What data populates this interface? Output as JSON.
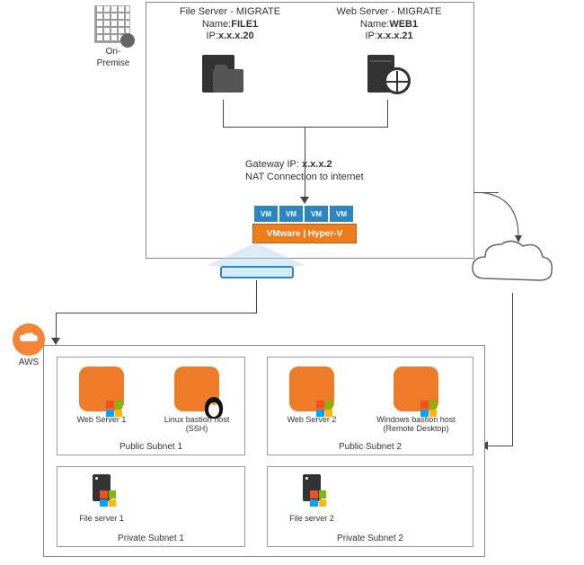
{
  "onprem": {
    "label": "On-\nPremise",
    "file_server": {
      "header": "File Server - MIGRATE",
      "name_label": "Name:",
      "name_value": "FILE1",
      "ip_label": "IP:",
      "ip_value": "x.x.x.20"
    },
    "web_server": {
      "header": "Web Server - MIGRATE",
      "name_label": "Name:",
      "name_value": "WEB1",
      "ip_label": "IP:",
      "ip_value": "x.x.x.21"
    },
    "gateway": {
      "line1_label": "Gateway IP: ",
      "line1_value": "x.x.x.2",
      "line2": "NAT Connection to internet",
      "vm_label": "VM",
      "hypervisor_label": "VMware | Hyper-V"
    }
  },
  "aws": {
    "label": "AWS",
    "public1": {
      "label": "Public Subnet 1",
      "items": [
        "Web Server 1",
        "Linux bastion host\n(SSH)"
      ]
    },
    "public2": {
      "label": "Public Subnet 2",
      "items": [
        "Web Server 2",
        "Windows bastion host\n(Remote Desktop)"
      ]
    },
    "private1": {
      "label": "Private Subnet 1",
      "items": [
        "File server 1"
      ]
    },
    "private2": {
      "label": "Private Subnet 2",
      "items": [
        "File server 2"
      ]
    }
  },
  "icons": {
    "onprem": "building-gear-icon",
    "file": "file-server-icon",
    "web": "web-server-globe-icon",
    "vm": "vm-icon",
    "hypervisor": "hypervisor-icon",
    "host": "physical-host-icon",
    "cloud": "internet-cloud-icon",
    "aws": "aws-cloud-icon",
    "ec2": "ec2-instance-icon",
    "windows": "windows-icon",
    "linux": "linux-penguin-icon",
    "server": "server-tower-icon"
  }
}
